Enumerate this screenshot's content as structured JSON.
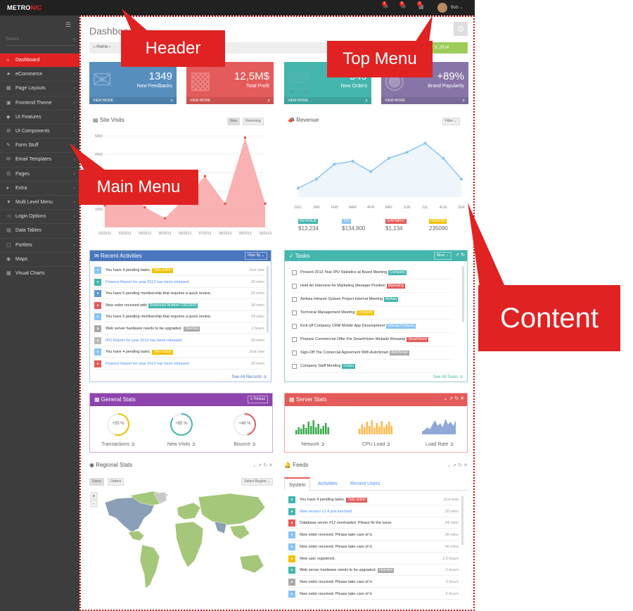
{
  "header": {
    "logo_main": "METRO",
    "logo_accent": "NIC",
    "badges": [
      "1",
      "6",
      "3"
    ],
    "username": "Bob"
  },
  "sidebar": {
    "search_placeholder": "Search...",
    "items": [
      {
        "label": "Dashboard",
        "icon": "home-icon"
      },
      {
        "label": "eCommerce",
        "icon": "cart-icon"
      },
      {
        "label": "Page Layouts",
        "icon": "layout-icon"
      },
      {
        "label": "Frontend Theme",
        "icon": "theme-icon"
      },
      {
        "label": "UI Features",
        "icon": "feature-icon"
      },
      {
        "label": "UI Components",
        "icon": "components-icon"
      },
      {
        "label": "Form Stuff",
        "icon": "form-icon"
      },
      {
        "label": "Email Templates",
        "icon": "email-icon"
      },
      {
        "label": "Pages",
        "icon": "pages-icon"
      },
      {
        "label": "Extra",
        "icon": "extra-icon"
      },
      {
        "label": "Multi Level Menu",
        "icon": "menu-icon"
      },
      {
        "label": "Login Options",
        "icon": "user-icon"
      },
      {
        "label": "Data Tables",
        "icon": "table-icon"
      },
      {
        "label": "Portlets",
        "icon": "portlet-icon"
      },
      {
        "label": "Maps",
        "icon": "map-icon"
      },
      {
        "label": "Visual Charts",
        "icon": "chart-icon"
      }
    ]
  },
  "page": {
    "title": "Dashboard",
    "breadcrumb_home": "Home",
    "date_range": "AY 3, 2014"
  },
  "stats": [
    {
      "value": "1349",
      "label": "New Feedbacks",
      "more": "VIEW MORE",
      "color": "#578ebe"
    },
    {
      "value": "12,5M$",
      "label": "Total Profit",
      "more": "VIEW MORE",
      "color": "#e35b5a"
    },
    {
      "value": "549",
      "label": "New Orders",
      "more": "VIEW MORE",
      "color": "#44b6ae"
    },
    {
      "value": "+89%",
      "label": "Brand Popularity",
      "more": "VIEW MORE",
      "color": "#8775a7"
    }
  ],
  "site_visits": {
    "title": "Site Visits",
    "tab_new": "New",
    "tab_returning": "Returning"
  },
  "revenue": {
    "title": "Revenue",
    "filter": "Filter",
    "summary": [
      {
        "label": "REVENUE",
        "value": "$13,234",
        "color": "#44b6ae"
      },
      {
        "label": "TAX",
        "value": "$134,900",
        "color": "#89c4f4"
      },
      {
        "label": "SHIPMENT",
        "value": "$1,134",
        "color": "#e35b5a"
      },
      {
        "label": "ORDERS",
        "value": "235090",
        "color": "#f3c200"
      }
    ]
  },
  "chart_data": [
    {
      "type": "area",
      "title": "Site Visits",
      "categories": [
        "02/2013",
        "03/2013",
        "04/2013",
        "05/2013",
        "06/2013",
        "07/2013",
        "08/2013",
        "09/2013",
        "10/2013"
      ],
      "values": [
        1200,
        2000,
        1100,
        500,
        1600,
        2800,
        1300,
        4900,
        1300
      ],
      "ylim": [
        0,
        5000
      ],
      "yticks": [
        "1000",
        "2000",
        "3000",
        "4000",
        "5000"
      ],
      "color": "#f9a9a9"
    },
    {
      "type": "line",
      "title": "Revenue",
      "categories": [
        "DEC",
        "JAN",
        "FEB",
        "MAR",
        "APR",
        "MAY",
        "JUN",
        "JUL",
        "AUG",
        "SEP"
      ],
      "values": [
        1300,
        1600,
        2100,
        2200,
        1850,
        2300,
        2500,
        2800,
        2300,
        1600
      ],
      "ylim": [
        1000,
        3000
      ],
      "color": "#89c4f4"
    }
  ],
  "recent_activities": {
    "title": "Recent Activities",
    "filter": "Filter By",
    "see_all": "See All Records",
    "rows": [
      {
        "text": "You have 4 pending tasks.",
        "tag": "Take action",
        "tag_color": "#f3c200",
        "time": "Just now",
        "color": "#89c4f4",
        "link": false
      },
      {
        "text": "Finance Report for year 2013 has been released.",
        "tag": "",
        "tag_color": "",
        "time": "20 mins",
        "color": "#44b6ae",
        "link": true
      },
      {
        "text": "You have 5 pending membership that requires a quick review.",
        "tag": "",
        "tag_color": "",
        "time": "24 mins",
        "color": "#5c9bd1",
        "link": false
      },
      {
        "text": "New order received with",
        "tag": "Reference Number: DR23923",
        "tag_color": "#44b6ae",
        "time": "30 mins",
        "color": "#e35b5a",
        "link": false
      },
      {
        "text": "You have 5 pending membership that requires a quick review.",
        "tag": "",
        "tag_color": "",
        "time": "24 mins",
        "color": "#89c4f4",
        "link": false
      },
      {
        "text": "Web server hardware needs to be upgraded.",
        "tag": "Overdue",
        "tag_color": "#aaaaaa",
        "time": "2 hours",
        "color": "#aaaaaa",
        "link": false
      },
      {
        "text": "IPO Report for year 2013 has been released.",
        "tag": "",
        "tag_color": "",
        "time": "20 mins",
        "color": "#bbbbbb",
        "link": true
      },
      {
        "text": "You have 4 pending tasks.",
        "tag": "Take action",
        "tag_color": "#f3c200",
        "time": "Just now",
        "color": "#89c4f4",
        "link": false
      },
      {
        "text": "Finance Report for year 2013 has been released.",
        "tag": "",
        "tag_color": "",
        "time": "20 mins",
        "color": "#e35b5a",
        "link": true
      }
    ]
  },
  "tasks": {
    "title": "Tasks",
    "more": "More",
    "see_all": "See All Tasks",
    "rows": [
      {
        "text": "Present 2013 Year IPO Statistics at Board Meeting",
        "tag": "Company",
        "tag_color": "#44b6ae"
      },
      {
        "text": "Hold An Interview for Marketing Manager Position",
        "tag": "Marketing",
        "tag_color": "#e35b5a"
      },
      {
        "text": "AirAsia Intranet System Project Internal Meeting",
        "tag": "AirAsia",
        "tag_color": "#44b6ae"
      },
      {
        "text": "Technical Management Meeting",
        "tag": "Company",
        "tag_color": "#f3c200"
      },
      {
        "text": "Kick-off Company CRM Mobile App Development",
        "tag": "Internal Products",
        "tag_color": "#89c4f4"
      },
      {
        "text": "Prepare Commercial Offer For SmartVision Website Rewamp",
        "tag": "SmartVision",
        "tag_color": "#e35b5a"
      },
      {
        "text": "Sign-Off The Comercial Agreement With AutoSmart",
        "tag": "AutoSmart",
        "tag_color": "#aaaaaa"
      },
      {
        "text": "Company Staff Meeting",
        "tag": "Cruise",
        "tag_color": "#44b6ae"
      }
    ]
  },
  "general_stats": {
    "title": "General Stats",
    "reload": "Reload",
    "items": [
      {
        "label": "Transactions",
        "value": "+55 %",
        "percent": 55,
        "color": "#f3c200"
      },
      {
        "label": "New Visits",
        "value": "+85 %",
        "percent": 85,
        "color": "#44b6ae"
      },
      {
        "label": "Bounce",
        "value": "+46 %",
        "percent": 46,
        "color": "#e35b5a"
      }
    ]
  },
  "server_stats": {
    "title": "Server Stats",
    "items": [
      {
        "label": "Network",
        "color": "#35aa47"
      },
      {
        "label": "CPU Load",
        "color": "#ffb848"
      },
      {
        "label": "Load Rate",
        "color": "#8fa8d8"
      }
    ]
  },
  "regional_stats": {
    "title": "Regional Stats",
    "tab_users": "Users",
    "tab_orders": "Orders",
    "select": "Select Region"
  },
  "feeds": {
    "title": "Feeds",
    "tabs": [
      "System",
      "Activities",
      "Recent Users"
    ],
    "rows": [
      {
        "text": "You have 4 pending tasks.",
        "tag": "Take action",
        "tag_color": "#e35b5a",
        "time": "Just now",
        "color": "#44b6ae",
        "link": false
      },
      {
        "text": "New version v1.4 just lunched!",
        "tag": "",
        "tag_color": "",
        "time": "20 mins",
        "color": "#44b6ae",
        "link": true
      },
      {
        "text": "Database server #12 overloaded. Please fix the issue.",
        "tag": "",
        "tag_color": "",
        "time": "24 mins",
        "color": "#e35b5a",
        "link": false
      },
      {
        "text": "New order received. Please take care of it.",
        "tag": "",
        "tag_color": "",
        "time": "30 mins",
        "color": "#89c4f4",
        "link": false
      },
      {
        "text": "New order received. Please take care of it.",
        "tag": "",
        "tag_color": "",
        "time": "40 mins",
        "color": "#89c4f4",
        "link": false
      },
      {
        "text": "New user registered.",
        "tag": "",
        "tag_color": "",
        "time": "1.5 hours",
        "color": "#f3c200",
        "link": false
      },
      {
        "text": "Web server hardware needs to be upgraded.",
        "tag": "Overdue",
        "tag_color": "#aaaaaa",
        "time": "2 hours",
        "color": "#44b6ae",
        "link": false
      },
      {
        "text": "New order received. Please take care of it.",
        "tag": "",
        "tag_color": "",
        "time": "3 hours",
        "color": "#aaaaaa",
        "link": false
      },
      {
        "text": "New order received. Please take care of it.",
        "tag": "",
        "tag_color": "",
        "time": "5 hours",
        "color": "#89c4f4",
        "link": false
      }
    ]
  },
  "callouts": {
    "header": "Header",
    "top_menu": "Top Menu",
    "main_menu": "Main Menu",
    "content": "Content",
    "color": "#e02222"
  }
}
